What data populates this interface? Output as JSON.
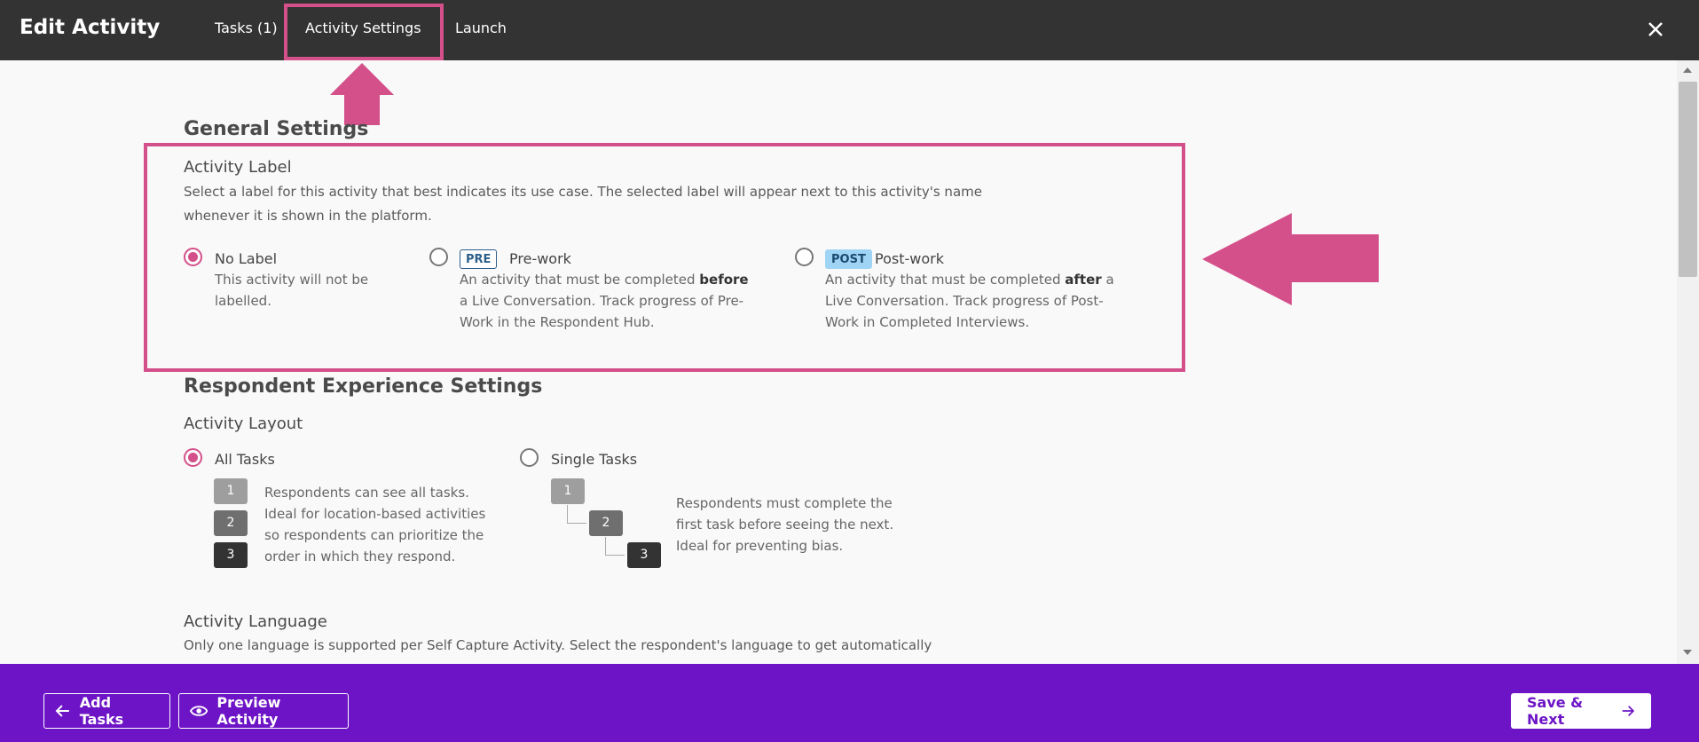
{
  "header": {
    "title": "Edit Activity",
    "tabs": [
      {
        "label": "Tasks (1)"
      },
      {
        "label": "Activity Settings"
      },
      {
        "label": "Launch"
      }
    ]
  },
  "general": {
    "heading": "General Settings",
    "activity_label": {
      "title": "Activity Label",
      "description_line1": "Select a label for this activity that best indicates its use case. The selected label will appear next to this activity's name",
      "description_line2": "whenever it is shown in the platform.",
      "options": [
        {
          "title": "No Label",
          "desc1": "This activity will not be",
          "desc2": "labelled.",
          "selected": true
        },
        {
          "badge": "PRE",
          "title": "Pre-work",
          "desc1_a": "An activity that must be completed ",
          "desc1_b": "before",
          "desc2": "a Live Conversation. Track progress of Pre-",
          "desc3": "Work in the Respondent Hub.",
          "selected": false
        },
        {
          "badge": "POST",
          "title": "Post-work",
          "desc1_a": "An activity that must be completed ",
          "desc1_b": "after",
          "desc1_c": " a",
          "desc2": "Live Conversation. Track progress of Post-",
          "desc3": "Work in Completed Interviews.",
          "selected": false
        }
      ]
    }
  },
  "respondent": {
    "heading": "Respondent Experience Settings",
    "layout": {
      "title": "Activity Layout",
      "all_tasks": {
        "label": "All Tasks",
        "selected": true,
        "numbers": [
          "1",
          "2",
          "3"
        ],
        "desc": [
          "Respondents can see all tasks.",
          "Ideal for location-based activities",
          "so respondents can prioritize the",
          "order in which they respond."
        ]
      },
      "single_tasks": {
        "label": "Single Tasks",
        "selected": false,
        "numbers": [
          "1",
          "2",
          "3"
        ],
        "desc": [
          "Respondents must complete the",
          "first task before seeing the next.",
          "Ideal for preventing bias."
        ]
      }
    },
    "language": {
      "title": "Activity Language",
      "desc": "Only one language is supported per Self Capture Activity. Select the respondent's language to get automatically"
    }
  },
  "footer": {
    "add_tasks": "Add Tasks",
    "preview": "Preview Activity",
    "save_next": "Save & Next"
  },
  "colors": {
    "topbar": "#333333",
    "accent_pink": "#d4508a",
    "footer_purple": "#6d15c6"
  }
}
